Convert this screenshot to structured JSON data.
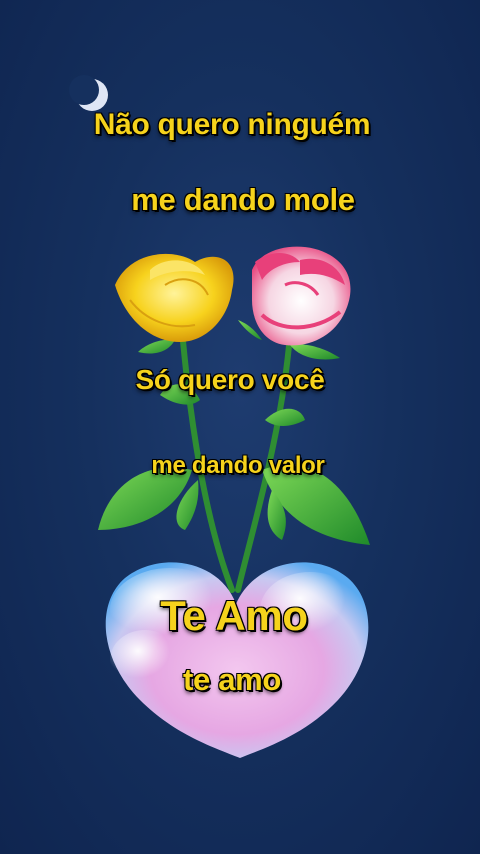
{
  "lines": {
    "line1": "Não quero ninguém",
    "line2": "me dando mole",
    "line3": "Só quero você",
    "line4": "me dando valor",
    "line5": "Te Amo",
    "line6": "te amo"
  },
  "colors": {
    "background": "#15305e",
    "text": "#f6d31c",
    "yellow_rose": "#f7d21d",
    "pink_rose": "#e8407a",
    "heart_blue": "#4aa3e8",
    "heart_pink": "#e7a3e6"
  }
}
